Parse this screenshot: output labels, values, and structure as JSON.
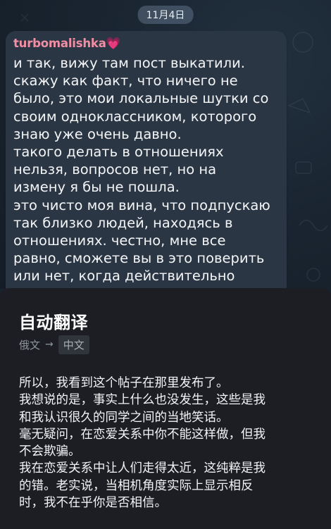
{
  "chat": {
    "date": "11月4日",
    "sender": "turbomalishka",
    "sender_emoji": "💗",
    "message_lines": [
      "и так, вижу там пост выкатили.",
      "скажу как факт, что ничего не",
      "было, это мои локальные шутки со",
      "своим одноклассником, которого",
      "знаю уже очень давно.",
      "такого делать в отношениях",
      "нельзя, вопросов нет, но на",
      "измену я бы не пошла.",
      "это чисто моя вина, что подпускаю",
      "так близко людей, находясь в",
      "отношениях. честно, мне все",
      "равно, сможете вы в это поверить",
      "или нет, когда действительно"
    ]
  },
  "translation": {
    "title": "自动翻译",
    "source_lang": "俄文",
    "arrow": "→",
    "target_lang": "中文",
    "lines": [
      "所以，我看到这个帖子在那里发布了。",
      "我想说的是，事实上什么也没发生，这些是我",
      "和我认识很久的同学之间的当地笑话。",
      "毫无疑问，在恋爱关系中你不能这样做，但我",
      "不会欺骗。",
      "我在恋爱关系中让人们走得太近，这纯粹是我",
      "的错。老实说，当相机角度实际上显示相反",
      "时，我不在乎你是否相信。"
    ]
  },
  "colors": {
    "chat_background": "#182330",
    "bubble": "#2b3644",
    "sender_name": "#f18ea4",
    "sheet": "#1c1e24"
  }
}
